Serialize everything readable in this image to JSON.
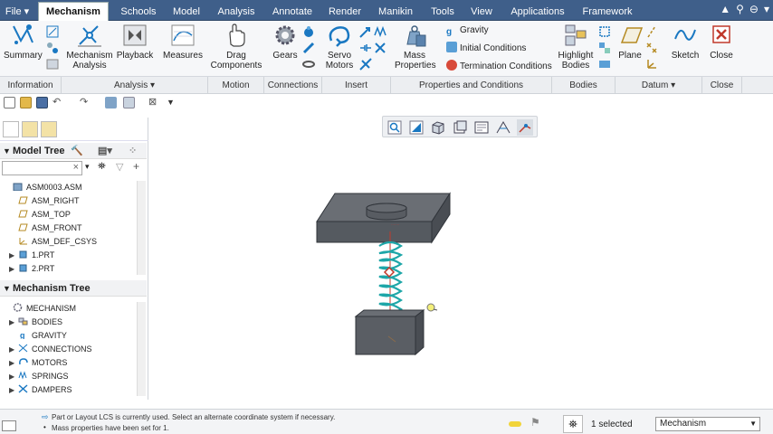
{
  "menu": {
    "tabs": [
      "File",
      "Mechanism",
      "Schools",
      "Model",
      "Analysis",
      "Annotate",
      "Render",
      "Manikin",
      "Tools",
      "View",
      "Applications",
      "Framework"
    ],
    "active": "Mechanism"
  },
  "ribbon": {
    "summary": "Summary",
    "mech_analysis_1": "Mechanism",
    "mech_analysis_2": "Analysis",
    "playback": "Playback",
    "measures": "Measures",
    "drag_1": "Drag",
    "drag_2": "Components",
    "gears": "Gears",
    "servo_1": "Servo",
    "servo_2": "Motors",
    "mass_1": "Mass",
    "mass_2": "Properties",
    "gravity": "Gravity",
    "initial_conditions": "Initial Conditions",
    "termination_conditions": "Termination Conditions",
    "highlight_1": "Highlight",
    "highlight_2": "Bodies",
    "plane": "Plane",
    "sketch": "Sketch",
    "close": "Close"
  },
  "groups": {
    "information": "Information",
    "analysis": "Analysis ▾",
    "motion": "Motion",
    "connections": "Connections",
    "insert": "Insert",
    "properties": "Properties and Conditions",
    "bodies": "Bodies",
    "datum": "Datum ▾",
    "close": "Close"
  },
  "model_tree": {
    "title": "Model Tree",
    "filter_clear": "×",
    "items": [
      {
        "label": "ASM0003.ASM",
        "icon": "assembly-icon",
        "indent": 0,
        "expander": ""
      },
      {
        "label": "ASM_RIGHT",
        "icon": "datum-plane-icon",
        "indent": 1,
        "expander": ""
      },
      {
        "label": "ASM_TOP",
        "icon": "datum-plane-icon",
        "indent": 1,
        "expander": ""
      },
      {
        "label": "ASM_FRONT",
        "icon": "datum-plane-icon",
        "indent": 1,
        "expander": ""
      },
      {
        "label": "ASM_DEF_CSYS",
        "icon": "csys-icon",
        "indent": 1,
        "expander": ""
      },
      {
        "label": "1.PRT",
        "icon": "part-icon",
        "indent": 1,
        "expander": "▶"
      },
      {
        "label": "2.PRT",
        "icon": "part-icon",
        "indent": 1,
        "expander": "▶"
      }
    ]
  },
  "mechanism_tree": {
    "title": "Mechanism Tree",
    "items": [
      {
        "label": "MECHANISM",
        "icon": "mechanism-icon",
        "indent": 0,
        "expander": ""
      },
      {
        "label": "BODIES",
        "icon": "bodies-icon",
        "indent": 1,
        "expander": "▶"
      },
      {
        "label": "GRAVITY",
        "icon": "gravity-icon",
        "indent": 1,
        "expander": ""
      },
      {
        "label": "CONNECTIONS",
        "icon": "connections-icon",
        "indent": 1,
        "expander": "▶"
      },
      {
        "label": "MOTORS",
        "icon": "motors-icon",
        "indent": 1,
        "expander": "▶"
      },
      {
        "label": "SPRINGS",
        "icon": "springs-icon",
        "indent": 1,
        "expander": "▶"
      },
      {
        "label": "DAMPERS",
        "icon": "dampers-icon",
        "indent": 1,
        "expander": "▶"
      }
    ]
  },
  "status": {
    "message_1": "Part or Layout LCS is currently used. Select an alternate coordinate system if necessary.",
    "message_2": "Mass properties have been set for 1.",
    "selected": "1 selected",
    "filter_value": "Mechanism"
  },
  "colors": {
    "menubar": "#3f5f8a",
    "spring": "#1ea6a8",
    "part": "#5c6066"
  }
}
